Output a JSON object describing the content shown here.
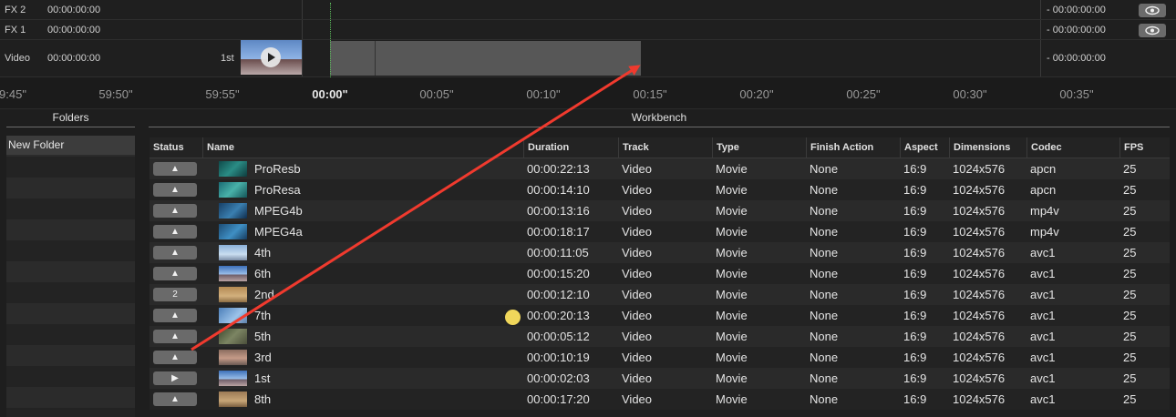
{
  "tracks": {
    "rows": [
      {
        "name": "FX 2",
        "time": "00:00:00:00",
        "end_time": "- 00:00:00:00",
        "has_eye": true
      },
      {
        "name": "FX 1",
        "time": "00:00:00:00",
        "end_time": "- 00:00:00:00",
        "has_eye": true
      },
      {
        "name": "Video",
        "time": "00:00:00:00",
        "end_time": "- 00:00:00:00",
        "has_eye": false
      }
    ],
    "clip_label": "1st"
  },
  "ruler": {
    "labels": [
      "9:45\"",
      "59:50\"",
      "59:55\"",
      "00:00\"",
      "00:05\"",
      "00:10\"",
      "00:15\"",
      "00:20\"",
      "00:25\"",
      "00:30\"",
      "00:35\""
    ]
  },
  "folders": {
    "title": "Folders",
    "items": [
      "New Folder"
    ]
  },
  "workbench": {
    "title": "Workbench",
    "columns": [
      "Status",
      "Name",
      "Duration",
      "Track",
      "Type",
      "Finish Action",
      "Aspect",
      "Dimensions",
      "Codec",
      "FPS"
    ],
    "rows": [
      {
        "status": "▲",
        "name": "ProResb",
        "duration": "00:00:22:13",
        "track": "Video",
        "type": "Movie",
        "finish": "None",
        "aspect": "16:9",
        "dims": "1024x576",
        "codec": "apcn",
        "fps": "25",
        "thumb": "teal"
      },
      {
        "status": "▲",
        "name": "ProResa",
        "duration": "00:00:14:10",
        "track": "Video",
        "type": "Movie",
        "finish": "None",
        "aspect": "16:9",
        "dims": "1024x576",
        "codec": "apcn",
        "fps": "25",
        "thumb": "teal2"
      },
      {
        "status": "▲",
        "name": "MPEG4b",
        "duration": "00:00:13:16",
        "track": "Video",
        "type": "Movie",
        "finish": "None",
        "aspect": "16:9",
        "dims": "1024x576",
        "codec": "mp4v",
        "fps": "25",
        "thumb": "blue"
      },
      {
        "status": "▲",
        "name": "MPEG4a",
        "duration": "00:00:18:17",
        "track": "Video",
        "type": "Movie",
        "finish": "None",
        "aspect": "16:9",
        "dims": "1024x576",
        "codec": "mp4v",
        "fps": "25",
        "thumb": "blue2"
      },
      {
        "status": "▲",
        "name": "4th",
        "duration": "00:00:11:05",
        "track": "Video",
        "type": "Movie",
        "finish": "None",
        "aspect": "16:9",
        "dims": "1024x576",
        "codec": "avc1",
        "fps": "25",
        "thumb": "sky"
      },
      {
        "status": "▲",
        "name": "6th",
        "duration": "00:00:15:20",
        "track": "Video",
        "type": "Movie",
        "finish": "None",
        "aspect": "16:9",
        "dims": "1024x576",
        "codec": "avc1",
        "fps": "25",
        "thumb": "sky2"
      },
      {
        "status": "2",
        "name": "2nd",
        "duration": "00:00:12:10",
        "track": "Video",
        "type": "Movie",
        "finish": "None",
        "aspect": "16:9",
        "dims": "1024x576",
        "codec": "avc1",
        "fps": "25",
        "thumb": "sand"
      },
      {
        "status": "▲",
        "name": "7th",
        "duration": "00:00:20:13",
        "track": "Video",
        "type": "Movie",
        "finish": "None",
        "aspect": "16:9",
        "dims": "1024x576",
        "codec": "avc1",
        "fps": "25",
        "thumb": "sky3"
      },
      {
        "status": "▲",
        "name": "5th",
        "duration": "00:00:05:12",
        "track": "Video",
        "type": "Movie",
        "finish": "None",
        "aspect": "16:9",
        "dims": "1024x576",
        "codec": "avc1",
        "fps": "25",
        "thumb": "ground"
      },
      {
        "status": "▲",
        "name": "3rd",
        "duration": "00:00:10:19",
        "track": "Video",
        "type": "Movie",
        "finish": "None",
        "aspect": "16:9",
        "dims": "1024x576",
        "codec": "avc1",
        "fps": "25",
        "thumb": "mix"
      },
      {
        "status": "▶",
        "name": "1st",
        "duration": "00:00:02:03",
        "track": "Video",
        "type": "Movie",
        "finish": "None",
        "aspect": "16:9",
        "dims": "1024x576",
        "codec": "avc1",
        "fps": "25",
        "thumb": "sky2"
      },
      {
        "status": "▲",
        "name": "8th",
        "duration": "00:00:17:20",
        "track": "Video",
        "type": "Movie",
        "finish": "None",
        "aspect": "16:9",
        "dims": "1024x576",
        "codec": "avc1",
        "fps": "25",
        "thumb": "sand2"
      }
    ]
  },
  "colors": {
    "annotation_arrow": "#f03a2e",
    "cursor_dot": "#f0d75b",
    "playhead": "#5bb85b"
  }
}
